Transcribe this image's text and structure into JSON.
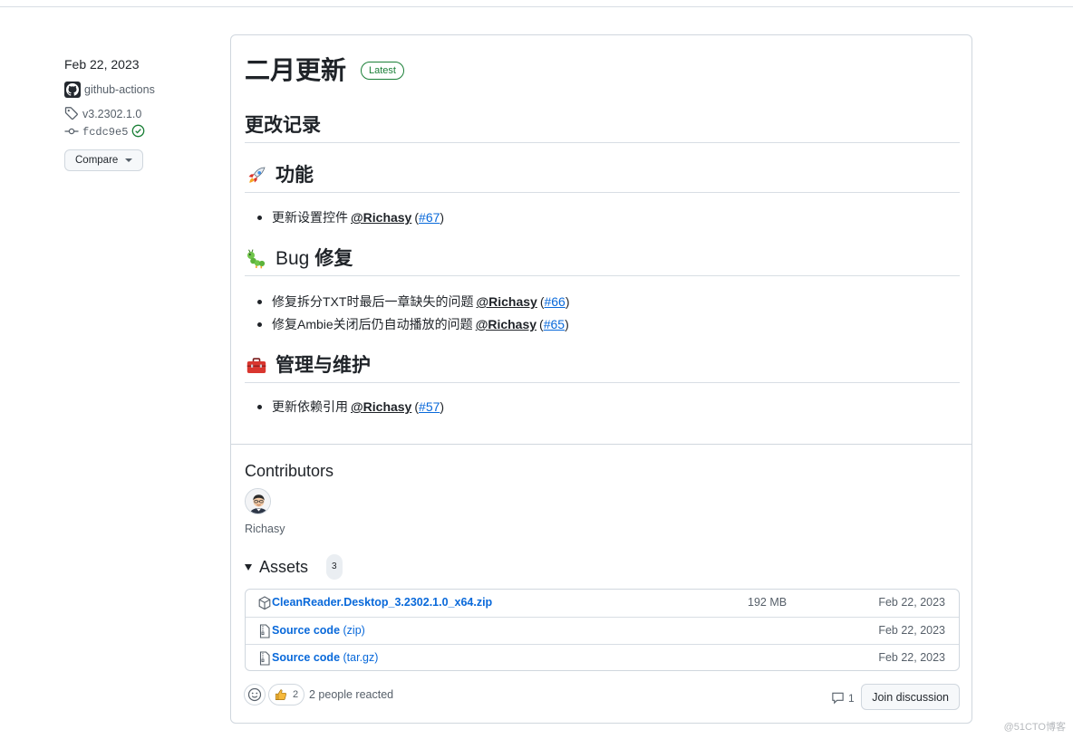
{
  "meta": {
    "date": "Feb 22, 2023",
    "author": "github-actions",
    "tag": "v3.2302.1.0",
    "commit": "fcdc9e5",
    "compare_label": "Compare"
  },
  "release": {
    "title": "二月更新",
    "badge": "Latest"
  },
  "changelog": {
    "heading": "更改记录",
    "sections": [
      {
        "icon": "rocket-icon",
        "title": "功能",
        "items": [
          {
            "text": "更新设置控件",
            "mention": "@Richasy",
            "ref": "#67"
          }
        ]
      },
      {
        "icon": "caterpillar-icon",
        "title_a": "Bug",
        "title_b": "修复",
        "items": [
          {
            "text": "修复拆分TXT时最后一章缺失的问题",
            "mention": "@Richasy",
            "ref": "#66"
          },
          {
            "text": "修复Ambie关闭后仍自动播放的问题",
            "mention": "@Richasy",
            "ref": "#65"
          }
        ]
      },
      {
        "icon": "toolbox-icon",
        "title": "管理与维护",
        "items": [
          {
            "text": "更新依赖引用",
            "mention": "@Richasy",
            "ref": "#57"
          }
        ]
      }
    ]
  },
  "contributors": {
    "title": "Contributors",
    "names": [
      "Richasy"
    ]
  },
  "assets": {
    "title": "Assets",
    "count": "3",
    "rows": [
      {
        "icon": "package-icon",
        "name": "CleanReader.Desktop_3.2302.1.0_x64.zip",
        "suffix": "",
        "size": "192 MB",
        "date": "Feb 22, 2023"
      },
      {
        "icon": "file-zip-icon",
        "name": "Source code",
        "suffix": "(zip)",
        "size": "",
        "date": "Feb 22, 2023"
      },
      {
        "icon": "file-zip-icon",
        "name": "Source code",
        "suffix": "(tar.gz)",
        "size": "",
        "date": "Feb 22, 2023"
      }
    ]
  },
  "reactions": {
    "thumbs_count": "2",
    "summary": "2 people reacted",
    "comments": "1",
    "join_label": "Join discussion"
  },
  "watermark": "@51CTO博客",
  "colors": {
    "link": "#0969da",
    "success": "#1a7f37",
    "border": "#d0d7de",
    "muted": "#57606a"
  }
}
